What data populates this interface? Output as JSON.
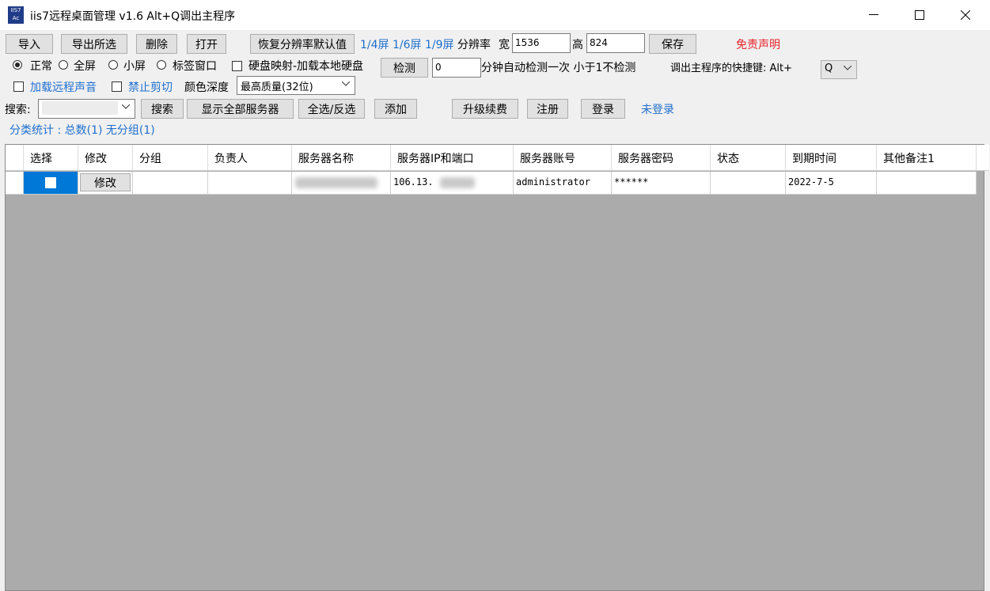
{
  "window": {
    "title": "iis7远程桌面管理 v1.6 Alt+Q调出主程序",
    "icon_text": "IIS7 Ac",
    "minimize": "—",
    "maximize": "☐",
    "close": "✕"
  },
  "toolbar1": {
    "import": "导入",
    "export_selected": "导出所选",
    "delete": "删除",
    "open": "打开",
    "restore_resolution": "恢复分辨率默认值",
    "screen_quarter": "1/4屏",
    "screen_sixth": "1/6屏",
    "screen_ninth": "1/9屏",
    "resolution_label": "分辨率",
    "width_label": "宽",
    "width_value": "1536",
    "height_label": "高",
    "height_value": "824",
    "save": "保存",
    "disclaimer": "免责声明"
  },
  "toolbar2": {
    "mode_normal": "正常",
    "mode_fullscreen": "全屏",
    "mode_small": "小屏",
    "mode_tab": "标签窗口",
    "disk_mapping": "硬盘映射-加载本地硬盘",
    "detect": "检测",
    "detect_minutes": "0",
    "detect_hint": "分钟自动检测一次 小于1不检测",
    "hotkey_label": "调出主程序的快捷键: Alt+",
    "hotkey_value": "Q"
  },
  "toolbar3": {
    "remote_sound": "加载远程声音",
    "disable_clipboard": "禁止剪切",
    "color_depth_label": "颜色深度",
    "color_depth_value": "最高质量(32位)"
  },
  "toolbar4": {
    "search_label": "搜索:",
    "search_value": "",
    "search": "搜索",
    "show_all": "显示全部服务器",
    "select_all": "全选/反选",
    "add": "添加",
    "upgrade": "升级续费",
    "register": "注册",
    "login": "登录",
    "login_status": "未登录"
  },
  "stats": {
    "text": "分类统计 : 总数(1) 无分组(1)"
  },
  "table": {
    "headers": [
      "选择",
      "修改",
      "分组",
      "负责人",
      "服务器名称",
      "服务器IP和端口",
      "服务器账号",
      "服务器密码",
      "状态",
      "到期时间",
      "其他备注1"
    ],
    "rows": [
      {
        "edit": "修改",
        "group": "",
        "owner": "",
        "name": "",
        "ip": "106.13.",
        "account": "administrator",
        "password": "******",
        "status": "",
        "expire": "2022-7-5",
        "note": ""
      }
    ]
  }
}
